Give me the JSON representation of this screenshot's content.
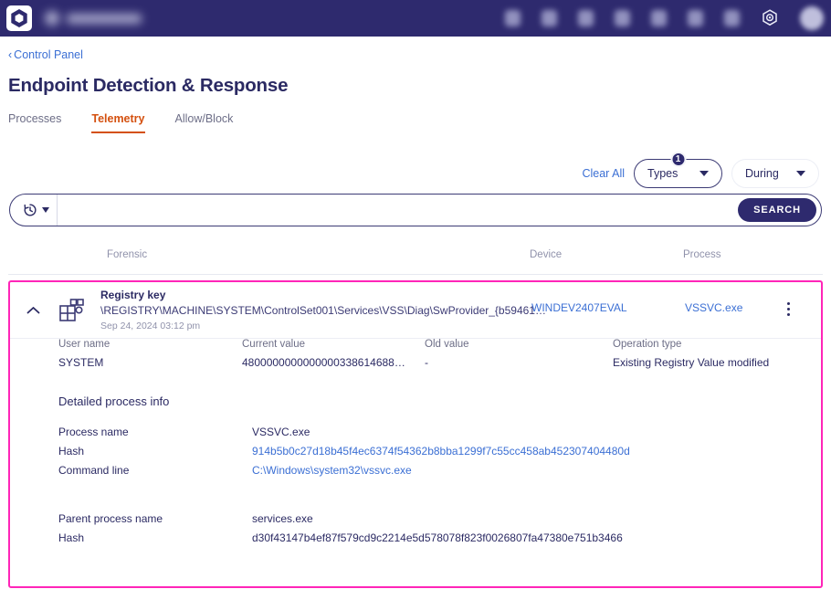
{
  "appbar": {
    "logo_icon": "hexagon-logo",
    "brand_label_redacted": "",
    "icons": [
      "search-icon",
      "devices-icon",
      "user-icon",
      "cloud-icon",
      "shield-icon",
      "lock-icon",
      "grid-icon"
    ],
    "settings_icon": "gear-icon",
    "avatar_icon": "user-avatar"
  },
  "breadcrumb": {
    "chevron": "‹",
    "label": "Control Panel"
  },
  "page_title": "Endpoint Detection & Response",
  "tabs": [
    {
      "label": "Processes",
      "active": false
    },
    {
      "label": "Telemetry",
      "active": true
    },
    {
      "label": "Allow/Block",
      "active": false
    }
  ],
  "filters": {
    "clear_all": "Clear All",
    "types": {
      "label": "Types",
      "badge": "1"
    },
    "during": {
      "label": "During"
    }
  },
  "search": {
    "history_icon": "clock-history-icon",
    "value": "",
    "placeholder": "",
    "button_label": "SEARCH"
  },
  "table": {
    "columns": [
      "Forensic",
      "Device",
      "Process"
    ],
    "row": {
      "icon": "registry-key-icon",
      "title": "Registry key",
      "path": "\\REGISTRY\\MACHINE\\SYSTEM\\ControlSet001\\Services\\VSS\\Diag\\SwProvider_{b59461…",
      "timestamp": "Sep 24, 2024 03:12 pm",
      "device": "WINDEV2407EVAL",
      "process": "VSSVC.exe"
    }
  },
  "detail": {
    "user_name": {
      "label": "User name",
      "value": "SYSTEM"
    },
    "current_value": {
      "label": "Current value",
      "value": "4800000000000000338614688…"
    },
    "old_value": {
      "label": "Old value",
      "value": "-"
    },
    "operation_type": {
      "label": "Operation type",
      "value": "Existing Registry Value modified"
    },
    "section_title": "Detailed process info",
    "process": [
      {
        "label": "Process name",
        "value": "VSSVC.exe",
        "link": false
      },
      {
        "label": "Hash",
        "value": "914b5b0c27d18b45f4ec6374f54362b8bba1299f7c55cc458ab452307404480d",
        "link": true
      },
      {
        "label": "Command line",
        "value": "C:\\Windows\\system32\\vssvc.exe",
        "link": true
      }
    ],
    "parent": [
      {
        "label": "Parent process name",
        "value": "services.exe",
        "link": false
      },
      {
        "label": "Hash",
        "value": "d30f43147b4ef87f579cd9c2214e5d578078f823f0026807fa47380e751b3466",
        "link": false
      }
    ]
  },
  "colors": {
    "appbar": "#2e2a6e",
    "accent_tab": "#d4500f",
    "link": "#3b6fd4",
    "highlight_border": "#ff25b8",
    "title": "#2b2a63"
  }
}
